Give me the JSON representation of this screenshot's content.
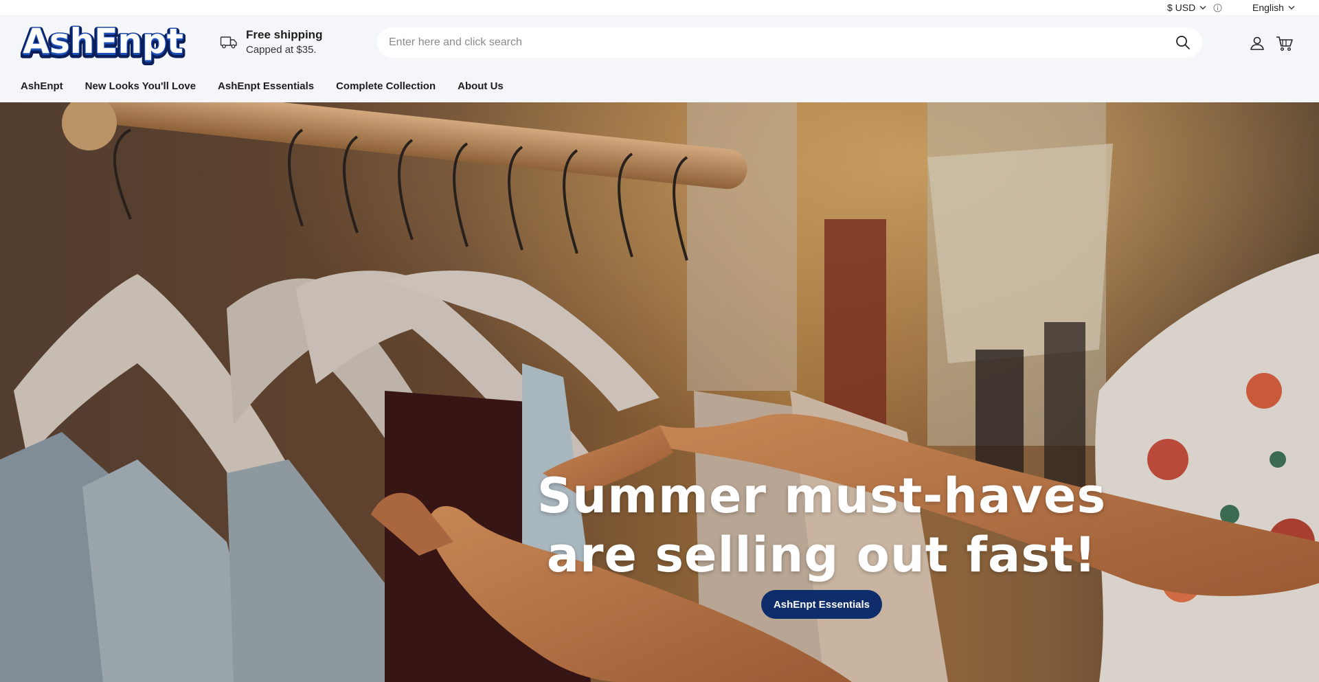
{
  "topbar": {
    "currency": "$ USD",
    "currency_info_icon": "info-icon",
    "language": "English"
  },
  "header": {
    "logo_text": "AshEnpt",
    "shipping": {
      "icon": "truck-icon",
      "title": "Free shipping",
      "subtitle": "Capped at $35."
    },
    "search": {
      "placeholder": "Enter here and click search",
      "value": "",
      "icon": "search-icon"
    },
    "account_icon": "user-icon",
    "cart_icon": "cart-icon"
  },
  "nav": {
    "items": [
      {
        "label": "AshEnpt"
      },
      {
        "label": "New Looks You'll Love"
      },
      {
        "label": "AshEnpt Essentials"
      },
      {
        "label": "Complete Collection"
      },
      {
        "label": "About Us"
      }
    ]
  },
  "hero": {
    "headline_line1": "Summer must-haves",
    "headline_line2": "are selling out fast!",
    "cta_label": "AshEnpt Essentials"
  },
  "colors": {
    "header_bg": "#f4f6fa",
    "cta_bg": "#0f2c6b",
    "logo_blue": "#1d4fb8"
  }
}
